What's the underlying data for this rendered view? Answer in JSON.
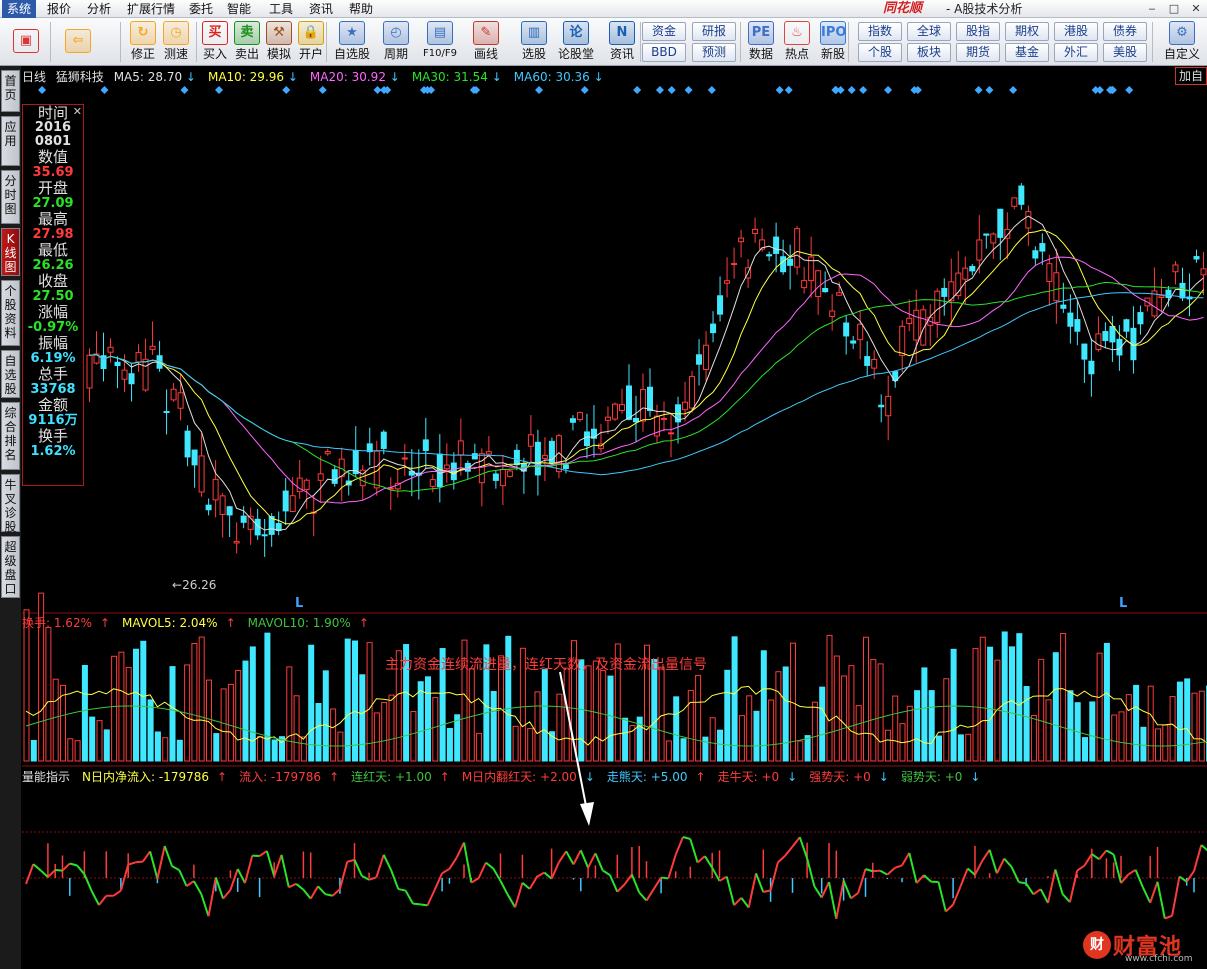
{
  "menu": [
    "系统",
    "报价",
    "分析",
    "扩展行情",
    "委托",
    "智能",
    "工具",
    "资讯",
    "帮助"
  ],
  "brand": "同花顺",
  "app_title": "- A股技术分析",
  "window_controls": [
    "minimize",
    "restore",
    "close"
  ],
  "toolbar": {
    "buttons": [
      {
        "label": "",
        "icon": "layout-icon"
      },
      {
        "label": "",
        "icon": "back-arrow-icon"
      },
      {
        "label": "修正",
        "icon": "refresh-icon"
      },
      {
        "label": "测速",
        "icon": "stopwatch-icon"
      },
      {
        "label": "买入",
        "icon": "buy-icon"
      },
      {
        "label": "卖出",
        "icon": "sell-icon"
      },
      {
        "label": "模拟",
        "icon": "hammer-icon"
      },
      {
        "label": "开户",
        "icon": "lock-icon"
      },
      {
        "label": "自选股",
        "icon": "star-icon"
      },
      {
        "label": "周期",
        "icon": "clock-icon"
      },
      {
        "label": "F10/F9",
        "icon": "f10-icon"
      },
      {
        "label": "画线",
        "icon": "pencil-icon"
      },
      {
        "label": "选股",
        "icon": "screen-icon"
      },
      {
        "label": "论股堂",
        "icon": "forum-icon"
      },
      {
        "label": "资讯",
        "icon": "news-icon"
      },
      {
        "label": "数据",
        "icon": "pe-icon"
      },
      {
        "label": "热点",
        "icon": "hot-icon"
      },
      {
        "label": "新股",
        "icon": "ipo-icon"
      },
      {
        "label": "自定义",
        "icon": "customize-icon"
      }
    ],
    "grid_a": [
      [
        "资金",
        "研报"
      ],
      [
        "BBD",
        "预测"
      ]
    ],
    "grid_b": [
      [
        "指数",
        "全球",
        "股指",
        "期权",
        "港股",
        "债券"
      ],
      [
        "个股",
        "板块",
        "期货",
        "基金",
        "外汇",
        "美股"
      ]
    ]
  },
  "sidebar": [
    "首页",
    "应用",
    "分时图",
    "K线图",
    "个股资料",
    "自选股",
    "综合排名",
    "牛叉诊股",
    "超级盘口"
  ],
  "sidebar_active": 3,
  "chart": {
    "period": "日线",
    "stock": "猛狮科技",
    "ma": [
      {
        "name": "MA5",
        "value": "28.70",
        "color": "#e0e0e0"
      },
      {
        "name": "MA10",
        "value": "29.96",
        "color": "#ffff40"
      },
      {
        "name": "MA20",
        "value": "30.92",
        "color": "#ff66ff"
      },
      {
        "name": "MA30",
        "value": "31.54",
        "color": "#29e329"
      },
      {
        "name": "MA60",
        "value": "30.36",
        "color": "#40c8ff"
      }
    ],
    "add_button": "加自",
    "low_label": "26.26",
    "annotation": "主力资金连续流进量，连红天数，及资金流出量信号",
    "l_marks": [
      "L",
      "L"
    ]
  },
  "info": {
    "time_label": "时间",
    "date_year": "2016",
    "date_md": "0801",
    "fields": [
      {
        "k": "数值",
        "v": "35.69",
        "c": "red"
      },
      {
        "k": "开盘",
        "v": "27.09",
        "c": "green"
      },
      {
        "k": "最高",
        "v": "27.98",
        "c": "red"
      },
      {
        "k": "最低",
        "v": "26.26",
        "c": "green"
      },
      {
        "k": "收盘",
        "v": "27.50",
        "c": "green"
      },
      {
        "k": "涨幅",
        "v": "-0.97%",
        "c": "green"
      },
      {
        "k": "振幅",
        "v": "6.19%",
        "c": "cyan"
      },
      {
        "k": "总手",
        "v": "33768",
        "c": "cyan"
      },
      {
        "k": "金额",
        "v": "9116万",
        "c": "cyan"
      },
      {
        "k": "换手",
        "v": "1.62%",
        "c": "cyan"
      }
    ]
  },
  "volume_header": [
    {
      "text": "换手: 1.62%",
      "color": "#ff3c3c",
      "arrow": "↑",
      "arrow_color": "#ff3c3c"
    },
    {
      "text": "MAVOL5: 2.04%",
      "color": "#ffff40",
      "arrow": "↑",
      "arrow_color": "#ff3c3c"
    },
    {
      "text": "MAVOL10: 1.90%",
      "color": "#3fc23f",
      "arrow": "↑",
      "arrow_color": "#ff3c3c"
    }
  ],
  "flow_header": [
    {
      "text": "量能指示",
      "color": "#e0e0e0",
      "arrow": "",
      "arrow_color": "#e0e0e0"
    },
    {
      "text": "N日内净流入: -179786",
      "color": "#ffff40",
      "arrow": "↑",
      "arrow_color": "#ff3c3c"
    },
    {
      "text": "流入: -179786",
      "color": "#ff3c3c",
      "arrow": "↑",
      "arrow_color": "#ff3c3c"
    },
    {
      "text": "连红天: +1.00",
      "color": "#3fc23f",
      "arrow": "↑",
      "arrow_color": "#ff3c3c"
    },
    {
      "text": "M日内翻红天: +2.00",
      "color": "#ff3c3c",
      "arrow": "↓",
      "arrow_color": "#40c8ff"
    },
    {
      "text": "走熊天: +5.00",
      "color": "#40c8ff",
      "arrow": "↑",
      "arrow_color": "#ff3c3c"
    },
    {
      "text": "走牛天: +0",
      "color": "#ff3c3c",
      "arrow": "↓",
      "arrow_color": "#40c8ff"
    },
    {
      "text": "强势天: +0",
      "color": "#ff3c3c",
      "arrow": "↓",
      "arrow_color": "#40c8ff"
    },
    {
      "text": "弱势天: +0",
      "color": "#3fc23f",
      "arrow": "↓",
      "arrow_color": "#40c8ff"
    }
  ],
  "watermark": {
    "logo": "财",
    "text": "财富池",
    "url": "www.cfchi.com"
  }
}
